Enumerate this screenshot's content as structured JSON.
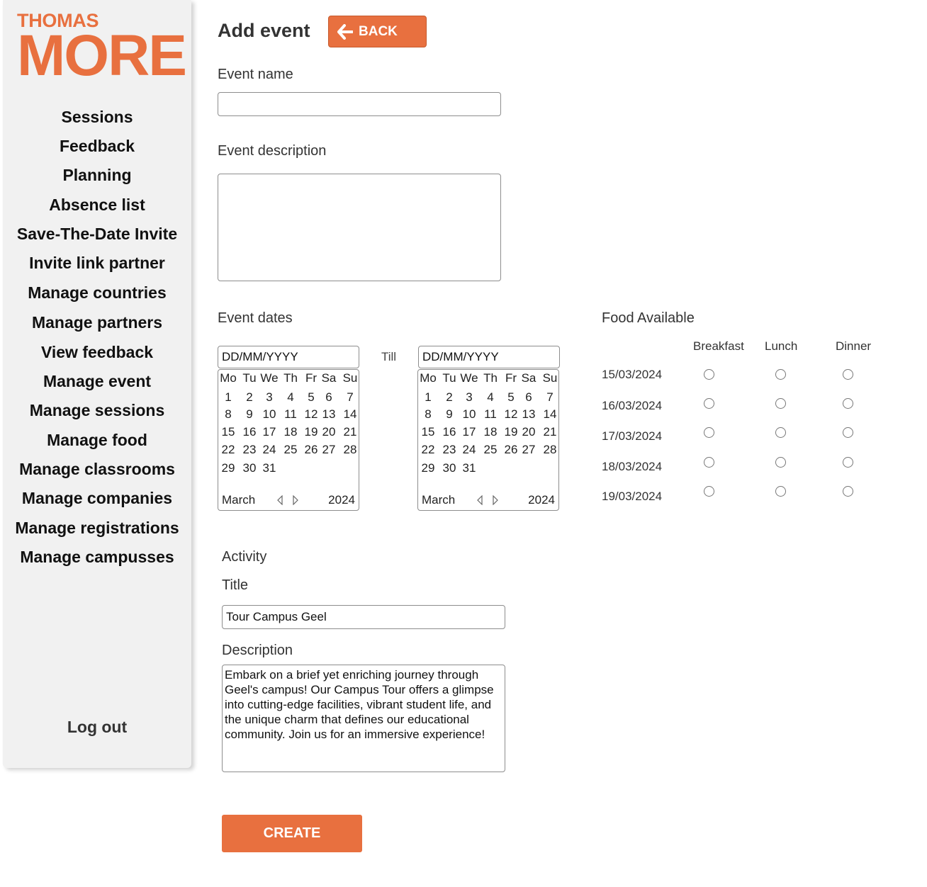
{
  "brand": {
    "line1": "THOMAS",
    "line2": "MORE",
    "accent_color": "#e8703f"
  },
  "sidebar": {
    "items": [
      {
        "label": "Sessions"
      },
      {
        "label": "Feedback"
      },
      {
        "label": "Planning"
      },
      {
        "label": "Absence list"
      },
      {
        "label": "Save-The-Date Invite"
      },
      {
        "label": "Invite link partner"
      },
      {
        "label": "Manage countries"
      },
      {
        "label": "Manage partners"
      },
      {
        "label": "View feedback"
      },
      {
        "label": "Manage event"
      },
      {
        "label": "Manage sessions"
      },
      {
        "label": "Manage food"
      },
      {
        "label": "Manage classrooms"
      },
      {
        "label": "Manage companies"
      },
      {
        "label": "Manage registrations"
      },
      {
        "label": "Manage campusses"
      }
    ],
    "logout_label": "Log out"
  },
  "header": {
    "title": "Add event",
    "back_label": "BACK",
    "back_icon": "arrow-left-icon"
  },
  "form": {
    "event_name_label": "Event name",
    "event_name_value": "",
    "event_description_label": "Event description",
    "event_description_value": "",
    "event_dates_label": "Event dates",
    "start_date_value": "DD/MM/YYYY",
    "till_label": "Till",
    "end_date_value": "DD/MM/YYYY",
    "activity_label": "Activity",
    "activity_title_label": "Title",
    "activity_title_value": "Tour Campus Geel",
    "activity_description_label": "Description",
    "activity_description_value": "Embark on a brief yet enriching journey through Geel's campus! Our Campus Tour offers a glimpse into cutting-edge facilities, vibrant student life, and the unique charm that defines our educational community. Join us for an immersive experience!",
    "create_label": "CREATE"
  },
  "calendar": {
    "weekdays": [
      "Mo",
      "Tu",
      "We",
      "Th",
      "Fr",
      "Sa",
      "Su"
    ],
    "weeks": [
      [
        "1",
        "2",
        "3",
        "4",
        "5",
        "6",
        "7"
      ],
      [
        "8",
        "9",
        "10",
        "11",
        "12",
        "13",
        "14"
      ],
      [
        "15",
        "16",
        "17",
        "18",
        "19",
        "20",
        "21"
      ],
      [
        "22",
        "23",
        "24",
        "25",
        "26",
        "27",
        "28"
      ],
      [
        "29",
        "30",
        "31",
        "",
        "",
        "",
        ""
      ]
    ],
    "month": "March",
    "year": "2024",
    "prev_icon": "triangle-left-icon",
    "next_icon": "triangle-right-icon"
  },
  "food": {
    "title": "Food Available",
    "columns": [
      "Breakfast",
      "Lunch",
      "Dinner"
    ],
    "dates": [
      "15/03/2024",
      "16/03/2024",
      "17/03/2024",
      "18/03/2024",
      "19/03/2024"
    ]
  }
}
